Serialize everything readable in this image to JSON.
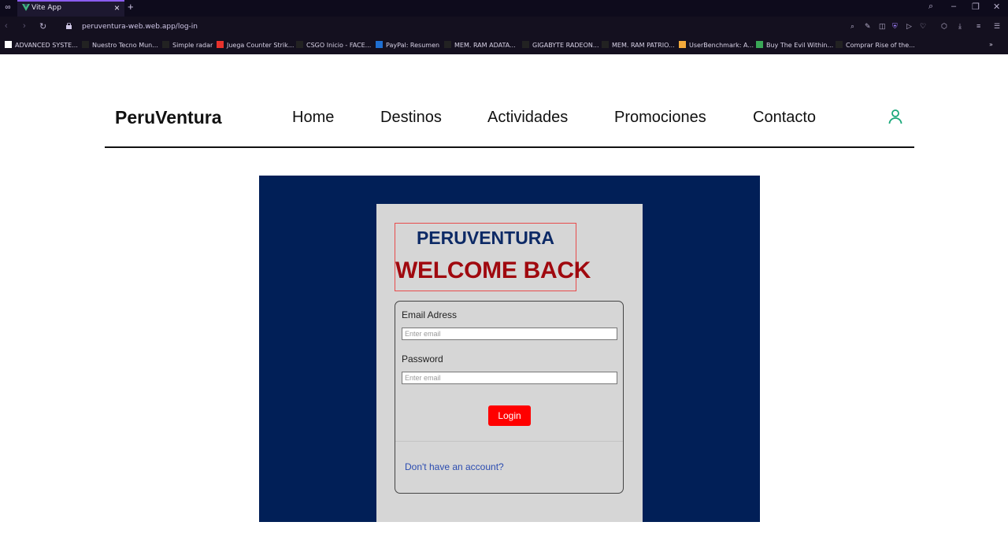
{
  "browser": {
    "tab_title": "Vite App",
    "url": "peruventura-web.web.app/log-in",
    "bookmarks": [
      {
        "label": "ADVANCED SYSTE...",
        "color": "#ffffff"
      },
      {
        "label": "Nuestro Tecno Mun...",
        "color": "#222222"
      },
      {
        "label": "Simple radar",
        "color": "#222222"
      },
      {
        "label": "Juega Counter Strik...",
        "color": "#e8322c"
      },
      {
        "label": "CSGO Inicio - FACE...",
        "color": "#222222"
      },
      {
        "label": "PayPal: Resumen",
        "color": "#1f6fd1"
      },
      {
        "label": "MEM. RAM ADATA...",
        "color": "#222222"
      },
      {
        "label": "GIGABYTE RADEON...",
        "color": "#222222"
      },
      {
        "label": "MEM. RAM PATRIO...",
        "color": "#222222"
      },
      {
        "label": "UserBenchmark: A...",
        "color": "#f2a93b"
      },
      {
        "label": "Buy The Evil Within...",
        "color": "#3aa757"
      },
      {
        "label": "Comprar Rise of the...",
        "color": "#222222"
      }
    ],
    "more_bookmarks": "»"
  },
  "header": {
    "brand": "PeruVentura",
    "nav": [
      "Home",
      "Destinos",
      "Actividades",
      "Promociones",
      "Contacto"
    ],
    "user_icon": "user-icon"
  },
  "login": {
    "brand_heading": "PERUVENTURA",
    "welcome": "WELCOME BACK",
    "email_label": "Email Adress",
    "email_placeholder": "Enter email",
    "password_label": "Password",
    "password_placeholder": "Enter email",
    "login_button": "Login",
    "signup_link": "Don't have an account?"
  },
  "colors": {
    "stage_background": "#011f57",
    "card_background": "#d6d6d6",
    "login_button": "#ff0000",
    "welcome_text": "#a0090f",
    "accent_icon": "#1aa87a"
  }
}
